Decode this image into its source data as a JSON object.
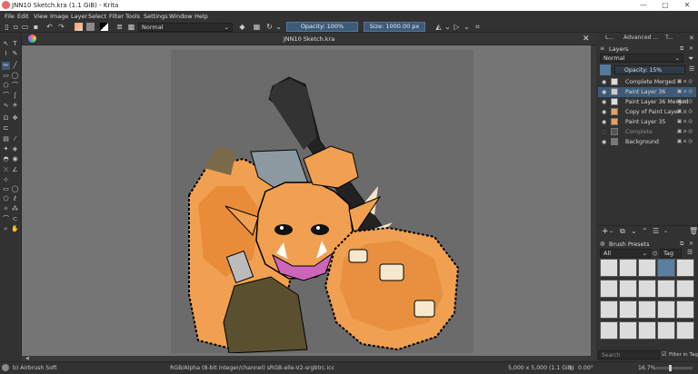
{
  "window": {
    "title": "JNN10 Sketch.kra (1.1 GiB) - Krita",
    "min": "—",
    "max": "▢",
    "close": "✕"
  },
  "menu": [
    "File",
    "Edit",
    "View",
    "Image",
    "Layer",
    "Select",
    "Filter",
    "Tools",
    "Settings",
    "Window",
    "Help"
  ],
  "toolbar": {
    "blend_mode": "Normal",
    "opacity": "Opacity: 100%",
    "size": "Size: 1000.00 px"
  },
  "document": {
    "tab_title": "JNN10 Sketch.kra",
    "close": "✕"
  },
  "dock_tabs": [
    "L...",
    "Advanced ...",
    "T..."
  ],
  "layers_panel": {
    "title": "Layers",
    "blend_mode": "Normal",
    "opacity": "Opacity:  15%",
    "layers": [
      {
        "name": "Complete Merged",
        "visible": true
      },
      {
        "name": "Paint Layer 36",
        "visible": true,
        "selected": true
      },
      {
        "name": "Paint Layer 36 Merged",
        "visible": true
      },
      {
        "name": "Copy of Paint Layer ...",
        "visible": true
      },
      {
        "name": "Paint Layer 35",
        "visible": true
      },
      {
        "name": "Complete",
        "visible": false
      },
      {
        "name": "Background",
        "visible": true
      }
    ]
  },
  "brush_presets": {
    "title": "Brush Presets",
    "filter": "All",
    "tag": "Tag",
    "search_placeholder": "Search",
    "filter_in_tag": "Filter in Tag"
  },
  "status": {
    "brush": "b) Airbrush Soft",
    "color": "RGB/Alpha (8-bit integer/channel)  sRGB-elle-V2-srgbtrc.icc",
    "dims": "5,000 x 5,000 (1.1 GiB)",
    "rotation": "0.00°",
    "zoom": "16.7%"
  },
  "colors": {
    "accent": "#3d5a78",
    "panel": "#323232",
    "canvas_bg": "#757575"
  }
}
